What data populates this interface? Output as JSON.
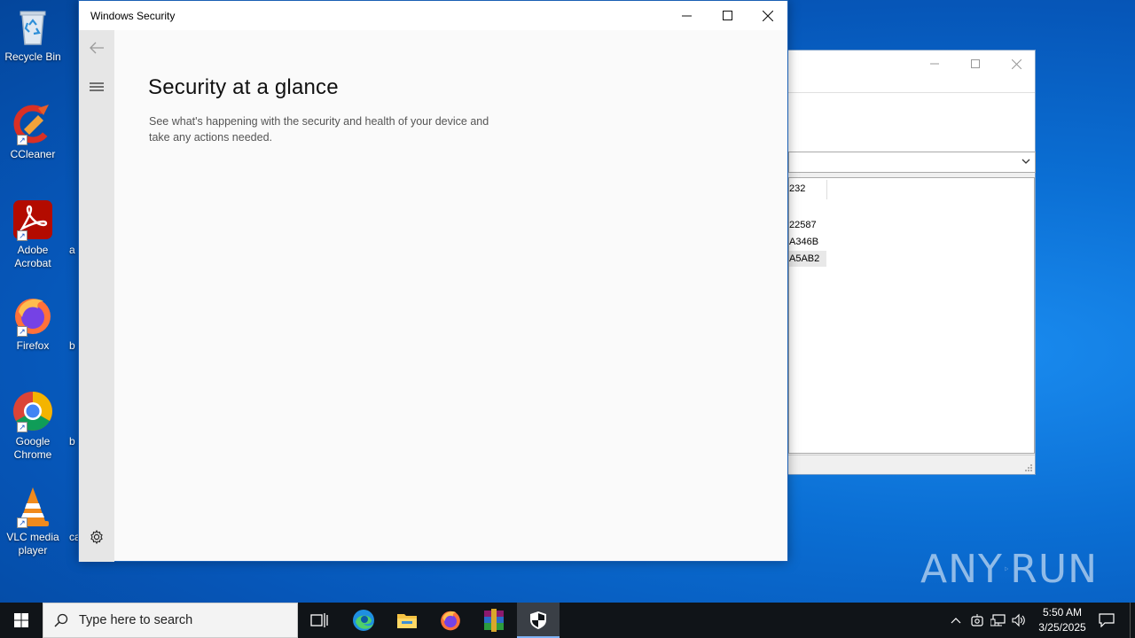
{
  "desktop": {
    "icons": [
      {
        "label": "Recycle Bin"
      },
      {
        "label": "CCleaner"
      },
      {
        "label": "Adobe Acrobat"
      },
      {
        "label": "Firefox"
      },
      {
        "label": "Google Chrome"
      },
      {
        "label": "VLC media player"
      }
    ],
    "partial_labels": [
      "a",
      "b",
      "b",
      "ca"
    ]
  },
  "background_window": {
    "list_rows": [
      "232",
      "22587",
      "A346B",
      "A5AB2"
    ]
  },
  "security_window": {
    "title": "Windows Security",
    "heading": "Security at a glance",
    "description": "See what's happening with the security and health of your device and take any actions needed."
  },
  "taskbar": {
    "search_placeholder": "Type here to search",
    "time": "5:50 AM",
    "date": "3/25/2025"
  },
  "watermark": {
    "left": "ANY",
    "right": "RUN"
  },
  "colors": {
    "desktop_blue": "#0b6fd4",
    "taskbar": "#101418",
    "accent": "#7fb3f5"
  }
}
